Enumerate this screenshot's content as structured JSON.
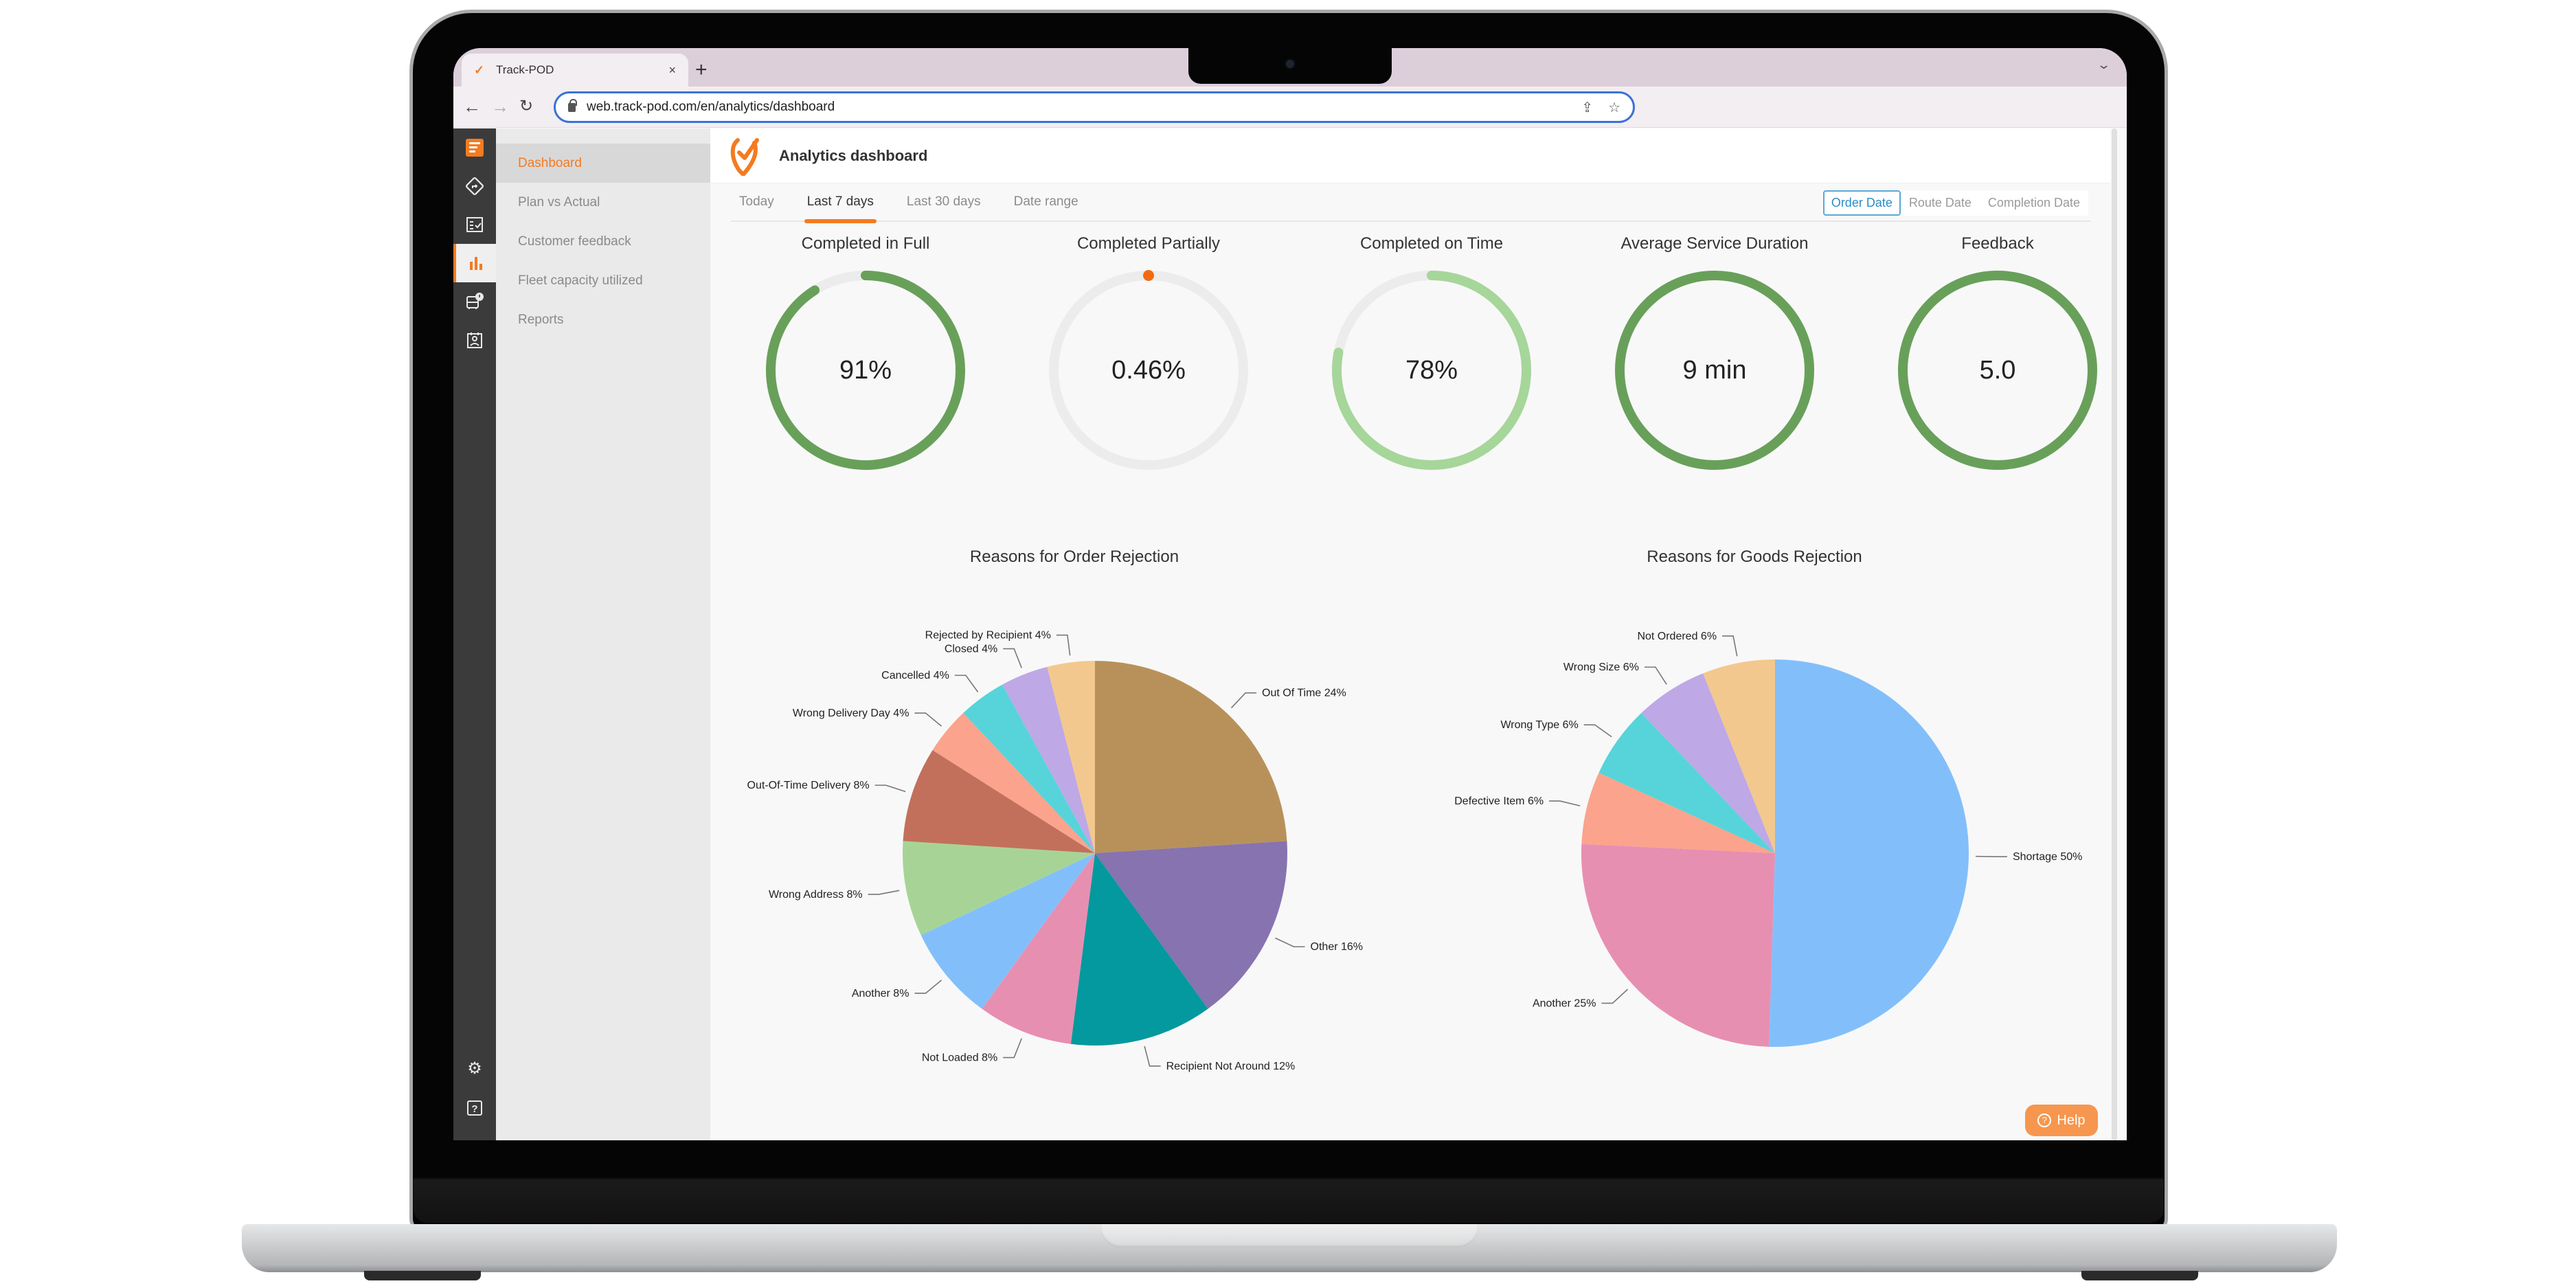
{
  "browser": {
    "tab_title": "Track-POD",
    "url": "web.track-pod.com/en/analytics/dashboard",
    "new_tab_label": "+",
    "close_label": "×"
  },
  "sidebar": {
    "items": [
      {
        "label": "Dashboard",
        "active": true
      },
      {
        "label": "Plan vs Actual",
        "active": false
      },
      {
        "label": "Customer feedback",
        "active": false
      },
      {
        "label": "Fleet capacity utilized",
        "active": false
      },
      {
        "label": "Reports",
        "active": false
      }
    ]
  },
  "rail": {
    "icons": [
      "dashboard-logo-icon",
      "route-icon",
      "checklist-icon",
      "analytics-bar-icon",
      "vehicle-alert-icon",
      "driver-badge-icon"
    ],
    "bottom_icons": [
      "settings-gear-icon",
      "help-question-icon"
    ],
    "active_index": 3
  },
  "header": {
    "title": "Analytics dashboard"
  },
  "range_tabs": [
    {
      "label": "Today",
      "active": false
    },
    {
      "label": "Last 7 days",
      "active": true
    },
    {
      "label": "Last 30 days",
      "active": false
    },
    {
      "label": "Date range",
      "active": false
    }
  ],
  "date_types": [
    {
      "label": "Order Date",
      "active": true
    },
    {
      "label": "Route Date",
      "active": false
    },
    {
      "label": "Completion Date",
      "active": false
    }
  ],
  "kpis": [
    {
      "title": "Completed in Full",
      "value": "91%",
      "fill_fraction": 0.91,
      "color": "#68a05a"
    },
    {
      "title": "Completed Partially",
      "value": "0.46%",
      "fill_fraction": 0.0046,
      "color": "#f26a10"
    },
    {
      "title": "Completed on Time",
      "value": "78%",
      "fill_fraction": 0.78,
      "color": "#a6d69a"
    },
    {
      "title": "Average Service Duration",
      "value": "9 min",
      "fill_fraction": 1.0,
      "color": "#68a05a"
    },
    {
      "title": "Feedback",
      "value": "5.0",
      "fill_fraction": 1.0,
      "color": "#68a05a"
    }
  ],
  "colors": {
    "accent": "#f47b20",
    "ring_track": "#ececec",
    "link_blue": "#2a8ec6"
  },
  "help_label": "Help",
  "chart_data": [
    {
      "type": "pie",
      "title": "Reasons for Order Rejection",
      "categories": [
        "Out Of Time",
        "Other",
        "Recipient Not Around",
        "Not Loaded",
        "Another",
        "Wrong Address",
        "Out-Of-Time Delivery",
        "Wrong Delivery Day",
        "Cancelled",
        "Closed",
        "Rejected by Recipient"
      ],
      "values": [
        24,
        16,
        12,
        8,
        8,
        8,
        8,
        4,
        4,
        4,
        4
      ],
      "labels": [
        "Out Of Time 24%",
        "Other 16%",
        "Recipient Not Around 12%",
        "Not Loaded 8%",
        "Another 8%",
        "Wrong Address 8%",
        "Out-Of-Time Delivery 8%",
        "Wrong Delivery Day 4%",
        "Cancelled 4%",
        "Closed 4%",
        "Rejected by Recipient 4%"
      ],
      "colors": [
        "#b8915a",
        "#8673b0",
        "#03999e",
        "#e78fb1",
        "#82bffa",
        "#a7d496",
        "#c2705c",
        "#fba38c",
        "#56d4da",
        "#bea8e6",
        "#f3c88e"
      ],
      "start": "12 o'clock",
      "direction": "clockwise"
    },
    {
      "type": "pie",
      "title": "Reasons for Goods Rejection",
      "categories": [
        "Shortage",
        "Another",
        "Defective Item",
        "Wrong Type",
        "Wrong Size",
        "Not Ordered"
      ],
      "values": [
        50,
        25,
        6,
        6,
        6,
        6
      ],
      "labels": [
        "Shortage 50%",
        "Another 25%",
        "Defective Item 6%",
        "Wrong Type 6%",
        "Wrong Size 6%",
        "Not Ordered 6%"
      ],
      "colors": [
        "#82bffa",
        "#e78fb1",
        "#fba38c",
        "#56d4da",
        "#bea8e6",
        "#f3c88e"
      ],
      "start": "12 o'clock",
      "direction": "clockwise"
    }
  ]
}
